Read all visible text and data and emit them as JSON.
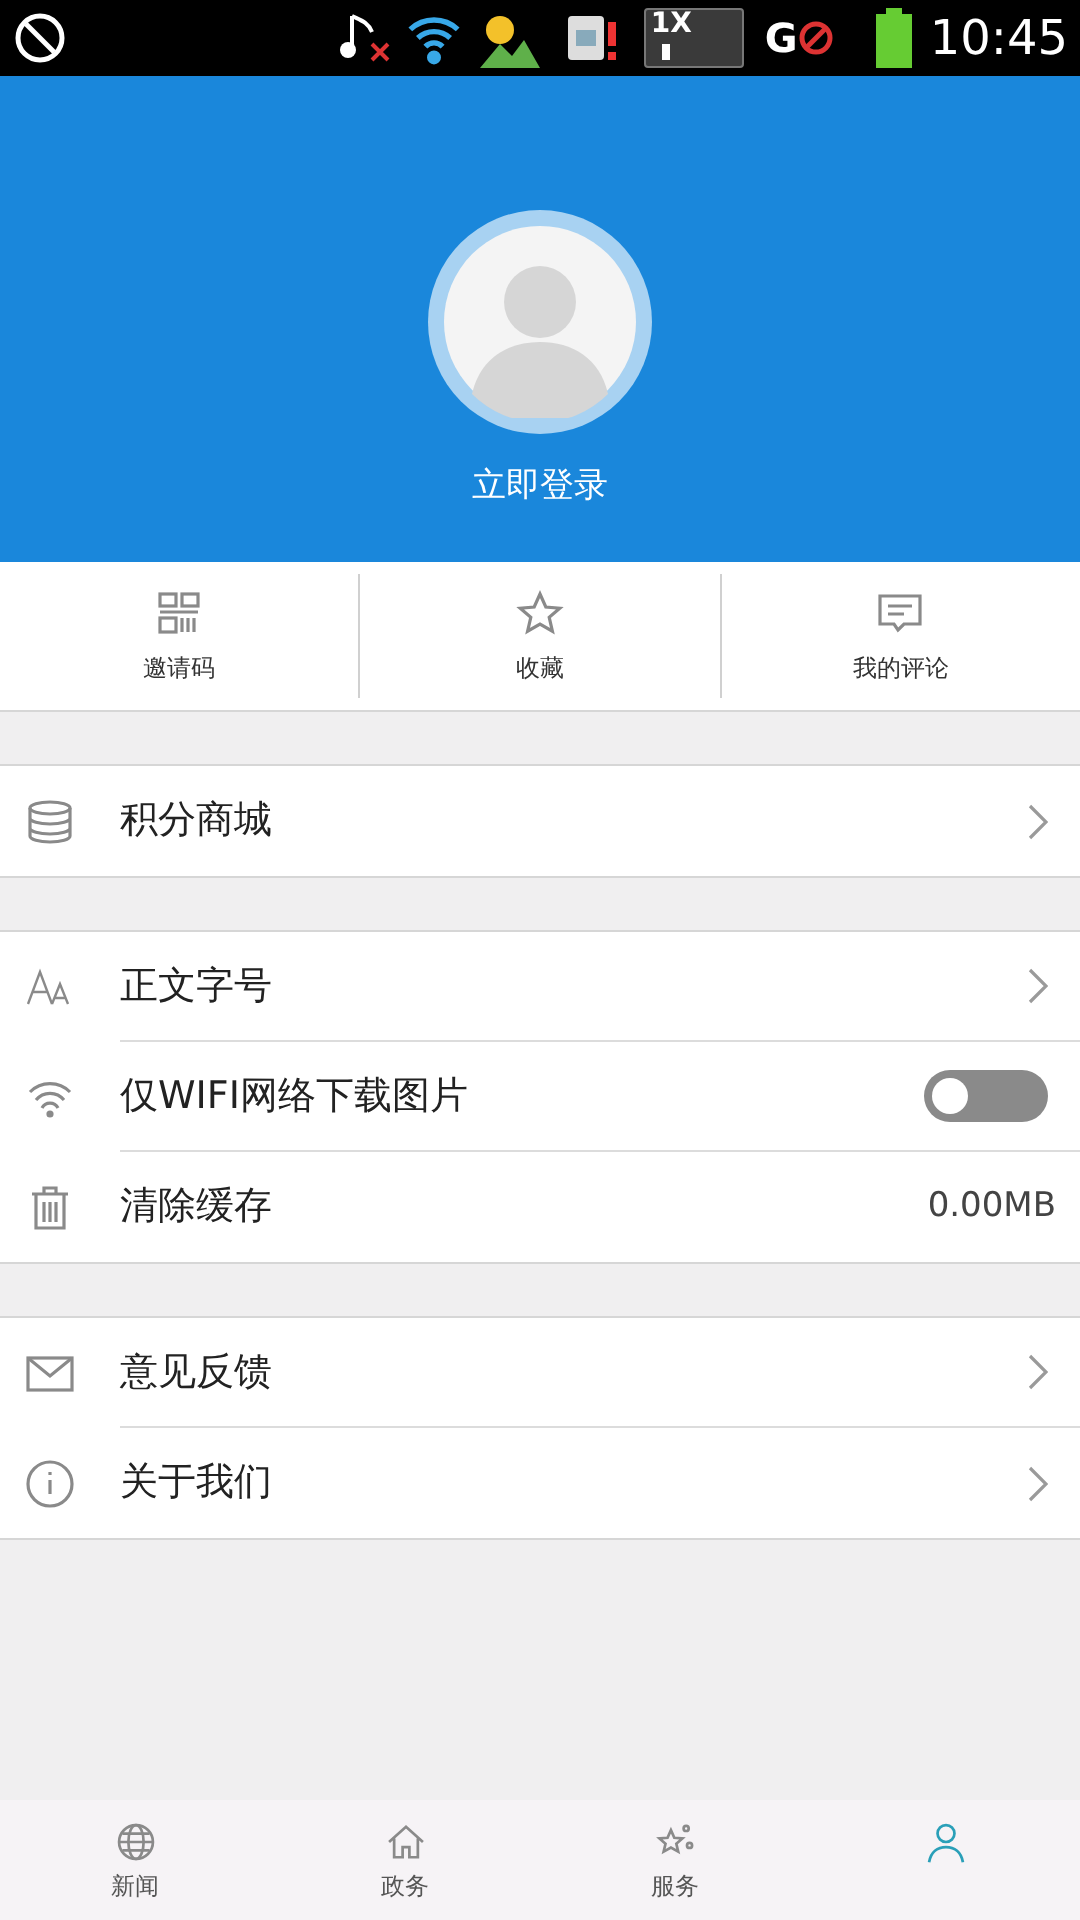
{
  "status_bar": {
    "network_label": "1X",
    "signal_label": "G",
    "time": "10:45"
  },
  "profile": {
    "login": "立即登录"
  },
  "quick_actions": [
    {
      "label": "邀请码"
    },
    {
      "label": "收藏"
    },
    {
      "label": "我的评论"
    }
  ],
  "groups": [
    [
      {
        "label": "积分商城",
        "kind": "link"
      }
    ],
    [
      {
        "label": "正文字号",
        "kind": "link"
      },
      {
        "label": "仅WIFI网络下载图片",
        "kind": "toggle",
        "on": false
      },
      {
        "label": "清除缓存",
        "kind": "value",
        "value": "0.00MB"
      }
    ],
    [
      {
        "label": "意见反馈",
        "kind": "link"
      },
      {
        "label": "关于我们",
        "kind": "link"
      }
    ]
  ],
  "tab_bar": [
    {
      "label": "新闻",
      "selected": false
    },
    {
      "label": "政务",
      "selected": false
    },
    {
      "label": "服务",
      "selected": false
    },
    {
      "selected": true
    }
  ]
}
